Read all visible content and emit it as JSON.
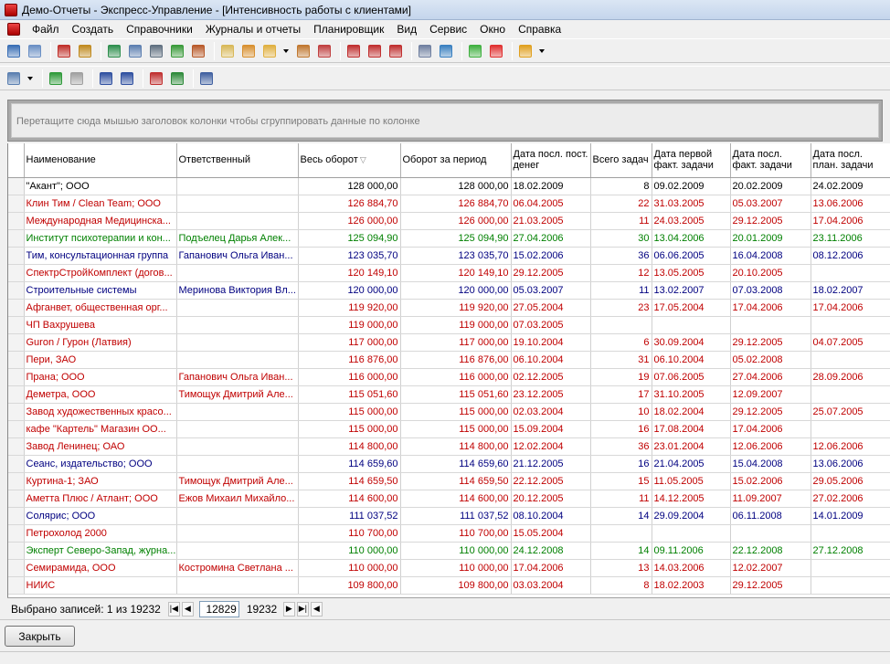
{
  "window": {
    "title": "Демо-Отчеты - Экспресс-Управление - [Интенсивность работы с клиентами]"
  },
  "menu": [
    "Файл",
    "Создать",
    "Справочники",
    "Журналы и отчеты",
    "Планировщик",
    "Вид",
    "Сервис",
    "Окно",
    "Справка"
  ],
  "toolbar1": [
    {
      "icon": "calendar-list-icon",
      "color": "#3a6fb5"
    },
    {
      "icon": "calendar-grid-icon",
      "color": "#6a8fc4"
    },
    {
      "icon": "user-red-icon",
      "color": "#c0302a"
    },
    {
      "icon": "users-group-icon",
      "color": "#c08a20"
    },
    {
      "icon": "book-icon",
      "color": "#2f8f4e"
    },
    {
      "icon": "document-list-icon",
      "color": "#5d7fb0"
    },
    {
      "icon": "contact-card-icon",
      "color": "#607080"
    },
    {
      "icon": "currency-icon",
      "color": "#3a9a3a"
    },
    {
      "icon": "briefcase-icon",
      "color": "#b85a2a"
    },
    {
      "icon": "report-icon",
      "color": "#d8b858"
    },
    {
      "icon": "bar-chart-icon",
      "color": "#d89030"
    },
    {
      "icon": "clipboard-icon",
      "color": "#e0b040"
    },
    {
      "icon": "forward-doc-icon",
      "color": "#c07830"
    },
    {
      "icon": "calendar-red-icon",
      "color": "#c04040"
    },
    {
      "icon": "letter-a-icon",
      "color": "#c03030"
    },
    {
      "icon": "letter-cu-icon",
      "color": "#c03030"
    },
    {
      "icon": "letter-p-icon",
      "color": "#c03030"
    },
    {
      "icon": "calculator-icon",
      "color": "#7080a0"
    },
    {
      "icon": "globe-icon",
      "color": "#3a80c0"
    },
    {
      "icon": "flag-green-icon",
      "color": "#40b040"
    },
    {
      "icon": "split-icon",
      "color": "#e03030"
    },
    {
      "icon": "clock-icon",
      "color": "#e0a020"
    }
  ],
  "toolbar2": [
    {
      "icon": "copy-icon",
      "color": "#5a7fb0"
    },
    {
      "icon": "refresh-icon",
      "color": "#2f9a3a"
    },
    {
      "icon": "stop-icon",
      "color": "#a0a0a0"
    },
    {
      "icon": "align-left-icon",
      "color": "#3050a0"
    },
    {
      "icon": "align-justify-icon",
      "color": "#3050a0"
    },
    {
      "icon": "filter-clear-icon",
      "color": "#c03030"
    },
    {
      "icon": "excel-icon",
      "color": "#2e8a3a"
    },
    {
      "icon": "window-icon",
      "color": "#4060a0"
    }
  ],
  "group_hint": "Перетащите сюда мышью заголовок колонки чтобы сгруппировать данные по колонке",
  "columns": [
    "Наименование",
    "Ответственный",
    "Весь оборот",
    "Оборот за период",
    "Дата посл. пост. денег",
    "Всего задач",
    "Дата первой факт. задачи",
    "Дата посл. факт. задачи",
    "Дата посл. план. задачи"
  ],
  "colors": {
    "black": "#000000",
    "red": "#c00000",
    "green": "#008000",
    "blue": "#000080"
  },
  "rows": [
    {
      "color": "black",
      "cells": [
        "\"Акант\"; ООО",
        "",
        "128 000,00",
        "128 000,00",
        "18.02.2009",
        "8",
        "09.02.2009",
        "20.02.2009",
        "24.02.2009"
      ]
    },
    {
      "color": "red",
      "cells": [
        "Клин Тим / Clean Team; ООО",
        "",
        "126 884,70",
        "126 884,70",
        "06.04.2005",
        "22",
        "31.03.2005",
        "05.03.2007",
        "13.06.2006"
      ]
    },
    {
      "color": "red",
      "cells": [
        "Международная Медицинска...",
        "",
        "126 000,00",
        "126 000,00",
        "21.03.2005",
        "11",
        "24.03.2005",
        "29.12.2005",
        "17.04.2006"
      ]
    },
    {
      "color": "green",
      "cells": [
        "Институт психотерапии и кон...",
        "Подъелец Дарья Алек...",
        "125 094,90",
        "125 094,90",
        "27.04.2006",
        "30",
        "13.04.2006",
        "20.01.2009",
        "23.11.2006"
      ]
    },
    {
      "color": "blue",
      "cells": [
        "Тим, консультационная группа",
        "Гапанович Ольга Иван...",
        "123 035,70",
        "123 035,70",
        "15.02.2006",
        "36",
        "06.06.2005",
        "16.04.2008",
        "08.12.2006"
      ]
    },
    {
      "color": "red",
      "cells": [
        "СпектрСтройКомплект (догов...",
        "",
        "120 149,10",
        "120 149,10",
        "29.12.2005",
        "12",
        "13.05.2005",
        "20.10.2005",
        ""
      ]
    },
    {
      "color": "blue",
      "cells": [
        "Строительные системы",
        "Меринова Виктория Вл...",
        "120 000,00",
        "120 000,00",
        "05.03.2007",
        "11",
        "13.02.2007",
        "07.03.2008",
        "18.02.2007"
      ]
    },
    {
      "color": "red",
      "cells": [
        "Афганвет, общественная орг...",
        "",
        "119 920,00",
        "119 920,00",
        "27.05.2004",
        "23",
        "17.05.2004",
        "17.04.2006",
        "17.04.2006"
      ]
    },
    {
      "color": "red",
      "cells": [
        "ЧП Вахрушева",
        "",
        "119 000,00",
        "119 000,00",
        "07.03.2005",
        "",
        "",
        "",
        ""
      ]
    },
    {
      "color": "red",
      "cells": [
        "Guron / Гурон (Латвия)",
        "",
        "117 000,00",
        "117 000,00",
        "19.10.2004",
        "6",
        "30.09.2004",
        "29.12.2005",
        "04.07.2005"
      ]
    },
    {
      "color": "red",
      "cells": [
        "Пери, ЗАО",
        "",
        "116 876,00",
        "116 876,00",
        "06.10.2004",
        "31",
        "06.10.2004",
        "05.02.2008",
        ""
      ]
    },
    {
      "color": "red",
      "cells": [
        "Прана; ООО",
        "Гапанович Ольга Иван...",
        "116 000,00",
        "116 000,00",
        "02.12.2005",
        "19",
        "07.06.2005",
        "27.04.2006",
        "28.09.2006"
      ]
    },
    {
      "color": "red",
      "cells": [
        "Деметра, ООО",
        "Тимощук Дмитрий Але...",
        "115 051,60",
        "115 051,60",
        "23.12.2005",
        "17",
        "31.10.2005",
        "12.09.2007",
        ""
      ]
    },
    {
      "color": "red",
      "cells": [
        "Завод художественных красо...",
        "",
        "115 000,00",
        "115 000,00",
        "02.03.2004",
        "10",
        "18.02.2004",
        "29.12.2005",
        "25.07.2005"
      ]
    },
    {
      "color": "red",
      "cells": [
        "кафе \"Картель\" Магазин ОО...",
        "",
        "115 000,00",
        "115 000,00",
        "15.09.2004",
        "16",
        "17.08.2004",
        "17.04.2006",
        ""
      ]
    },
    {
      "color": "red",
      "cells": [
        "Завод Ленинец; ОАО",
        "",
        "114 800,00",
        "114 800,00",
        "12.02.2004",
        "36",
        "23.01.2004",
        "12.06.2006",
        "12.06.2006"
      ]
    },
    {
      "color": "blue",
      "cells": [
        "Сеанс, издательство; ООО",
        "",
        "114 659,60",
        "114 659,60",
        "21.12.2005",
        "16",
        "21.04.2005",
        "15.04.2008",
        "13.06.2006"
      ]
    },
    {
      "color": "red",
      "cells": [
        "Куртина-1; ЗАО",
        "Тимощук Дмитрий Але...",
        "114 659,50",
        "114 659,50",
        "22.12.2005",
        "15",
        "11.05.2005",
        "15.02.2006",
        "29.05.2006"
      ]
    },
    {
      "color": "red",
      "cells": [
        "Аметта Плюс / Атлант; ООО",
        "Ежов Михаил Михайло...",
        "114 600,00",
        "114 600,00",
        "20.12.2005",
        "11",
        "14.12.2005",
        "11.09.2007",
        "27.02.2006"
      ]
    },
    {
      "color": "blue",
      "cells": [
        "Солярис; ООО",
        "",
        "111 037,52",
        "111 037,52",
        "08.10.2004",
        "14",
        "29.09.2004",
        "06.11.2008",
        "14.01.2009"
      ]
    },
    {
      "color": "red",
      "cells": [
        "Петрохолод 2000",
        "",
        "110 700,00",
        "110 700,00",
        "15.05.2004",
        "",
        "",
        "",
        ""
      ]
    },
    {
      "color": "green",
      "cells": [
        "Эксперт Северо-Запад, журна...",
        "",
        "110 000,00",
        "110 000,00",
        "24.12.2008",
        "14",
        "09.11.2006",
        "22.12.2008",
        "27.12.2008"
      ]
    },
    {
      "color": "red",
      "cells": [
        "Семирамида, ООО",
        "Костромина Светлана ...",
        "110 000,00",
        "110 000,00",
        "17.04.2006",
        "13",
        "14.03.2006",
        "12.02.2007",
        ""
      ]
    },
    {
      "color": "red",
      "cells": [
        "НИИС",
        "",
        "109 800,00",
        "109 800,00",
        "03.03.2004",
        "8",
        "18.02.2003",
        "29.12.2005",
        ""
      ]
    }
  ],
  "navigator": {
    "records_label": "Выбрано записей: 1 из 19232",
    "current": "12829",
    "total": "19232"
  },
  "close_label": "Закрыть"
}
